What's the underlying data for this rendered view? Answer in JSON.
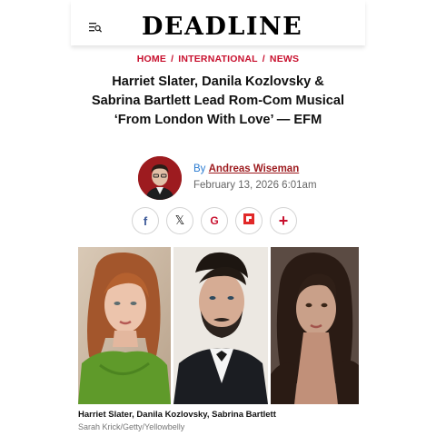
{
  "site": {
    "logo": "DEADLINE"
  },
  "breadcrumb": {
    "home": "HOME",
    "international": "INTERNATIONAL",
    "news": "NEWS",
    "separator": "/"
  },
  "article": {
    "headline": "Harriet Slater, Danila Kozlovsky & Sabrina Bartlett Lead Rom-Com Musical ‘From London With Love’ — EFM",
    "by_label": "By",
    "author": "Andreas Wiseman",
    "date": "February 13, 2026 6:01am"
  },
  "share": {
    "facebook": "f",
    "x": "𝕏",
    "google": "G",
    "flipboard": "flipboard-icon",
    "more": "+"
  },
  "image": {
    "caption": "Harriet Slater, Danila Kozlovsky, Sabrina Bartlett",
    "credit": "Sarah Krick/Getty/Yellowbelly"
  },
  "colors": {
    "brand_red": "#c8102e",
    "author_red": "#9d1b1f",
    "link_blue": "#2a7bd1"
  }
}
